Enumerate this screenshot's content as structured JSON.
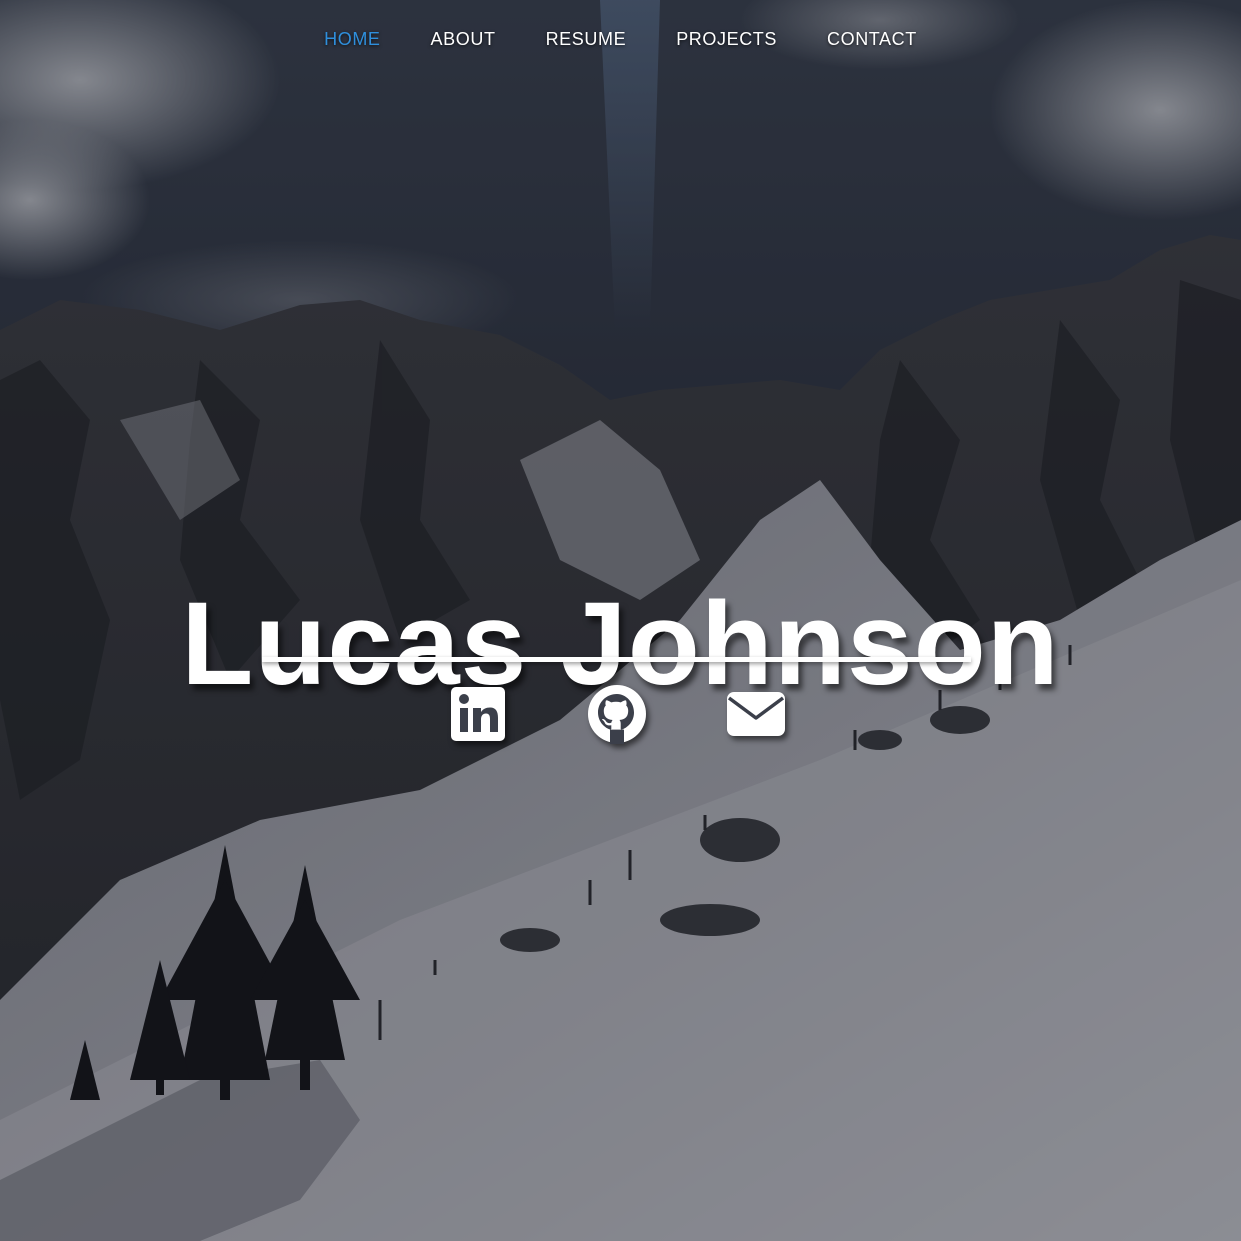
{
  "nav": {
    "items": [
      {
        "label": "HOME",
        "active": true
      },
      {
        "label": "ABOUT",
        "active": false
      },
      {
        "label": "RESUME",
        "active": false
      },
      {
        "label": "PROJECTS",
        "active": false
      },
      {
        "label": "CONTACT",
        "active": false
      }
    ],
    "active_color": "#2f8fdc",
    "text_color": "#ffffff"
  },
  "hero": {
    "name": "Lucas Johnson"
  },
  "social": {
    "icons": [
      "linkedin-icon",
      "github-icon",
      "email-icon"
    ]
  }
}
